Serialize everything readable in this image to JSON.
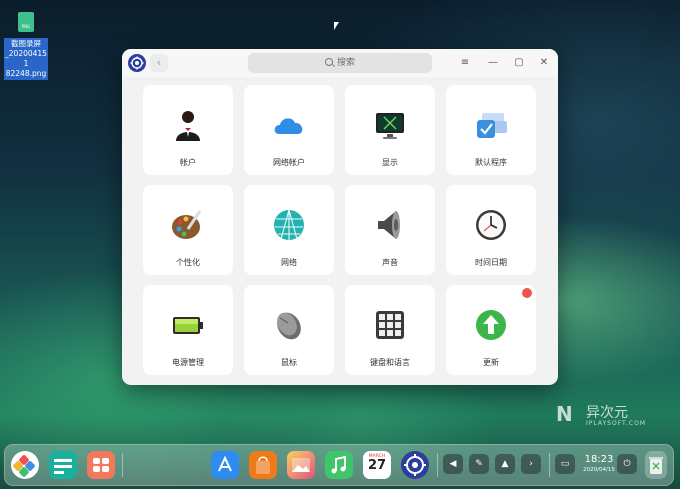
{
  "desktop": {
    "file_icon_text": "PNG",
    "file_name_line1": "截图录屏",
    "file_name_line2": "_202004151",
    "file_name_line3": "82248.png"
  },
  "window": {
    "search_placeholder": "搜索",
    "back_glyph": "‹",
    "menu_glyph": "≡",
    "minimize_glyph": "—",
    "maximize_glyph": "▢",
    "close_glyph": "✕"
  },
  "tiles": [
    {
      "label": "帐户",
      "icon": "account-icon"
    },
    {
      "label": "网络帐户",
      "icon": "cloud-icon"
    },
    {
      "label": "显示",
      "icon": "display-icon"
    },
    {
      "label": "默认程序",
      "icon": "default-apps-icon"
    },
    {
      "label": "个性化",
      "icon": "palette-icon"
    },
    {
      "label": "网络",
      "icon": "network-icon"
    },
    {
      "label": "声音",
      "icon": "speaker-icon"
    },
    {
      "label": "时间日期",
      "icon": "clock-icon"
    },
    {
      "label": "电源管理",
      "icon": "battery-icon"
    },
    {
      "label": "鼠标",
      "icon": "mouse-icon"
    },
    {
      "label": "键盘和语言",
      "icon": "keyboard-icon"
    },
    {
      "label": "更新",
      "icon": "update-icon"
    }
  ],
  "watermark": {
    "logo": "N",
    "text": "异次元",
    "sub": "IPLAYSOFT.COM"
  },
  "dock": {
    "calendar_month": "MARCH",
    "calendar_day": "27",
    "time": "18:23",
    "date": "2020/04/15"
  },
  "colors": {
    "accent_blue": "#2c3e9c",
    "badge_red": "#f0544f",
    "update_green": "#3cb54a"
  }
}
